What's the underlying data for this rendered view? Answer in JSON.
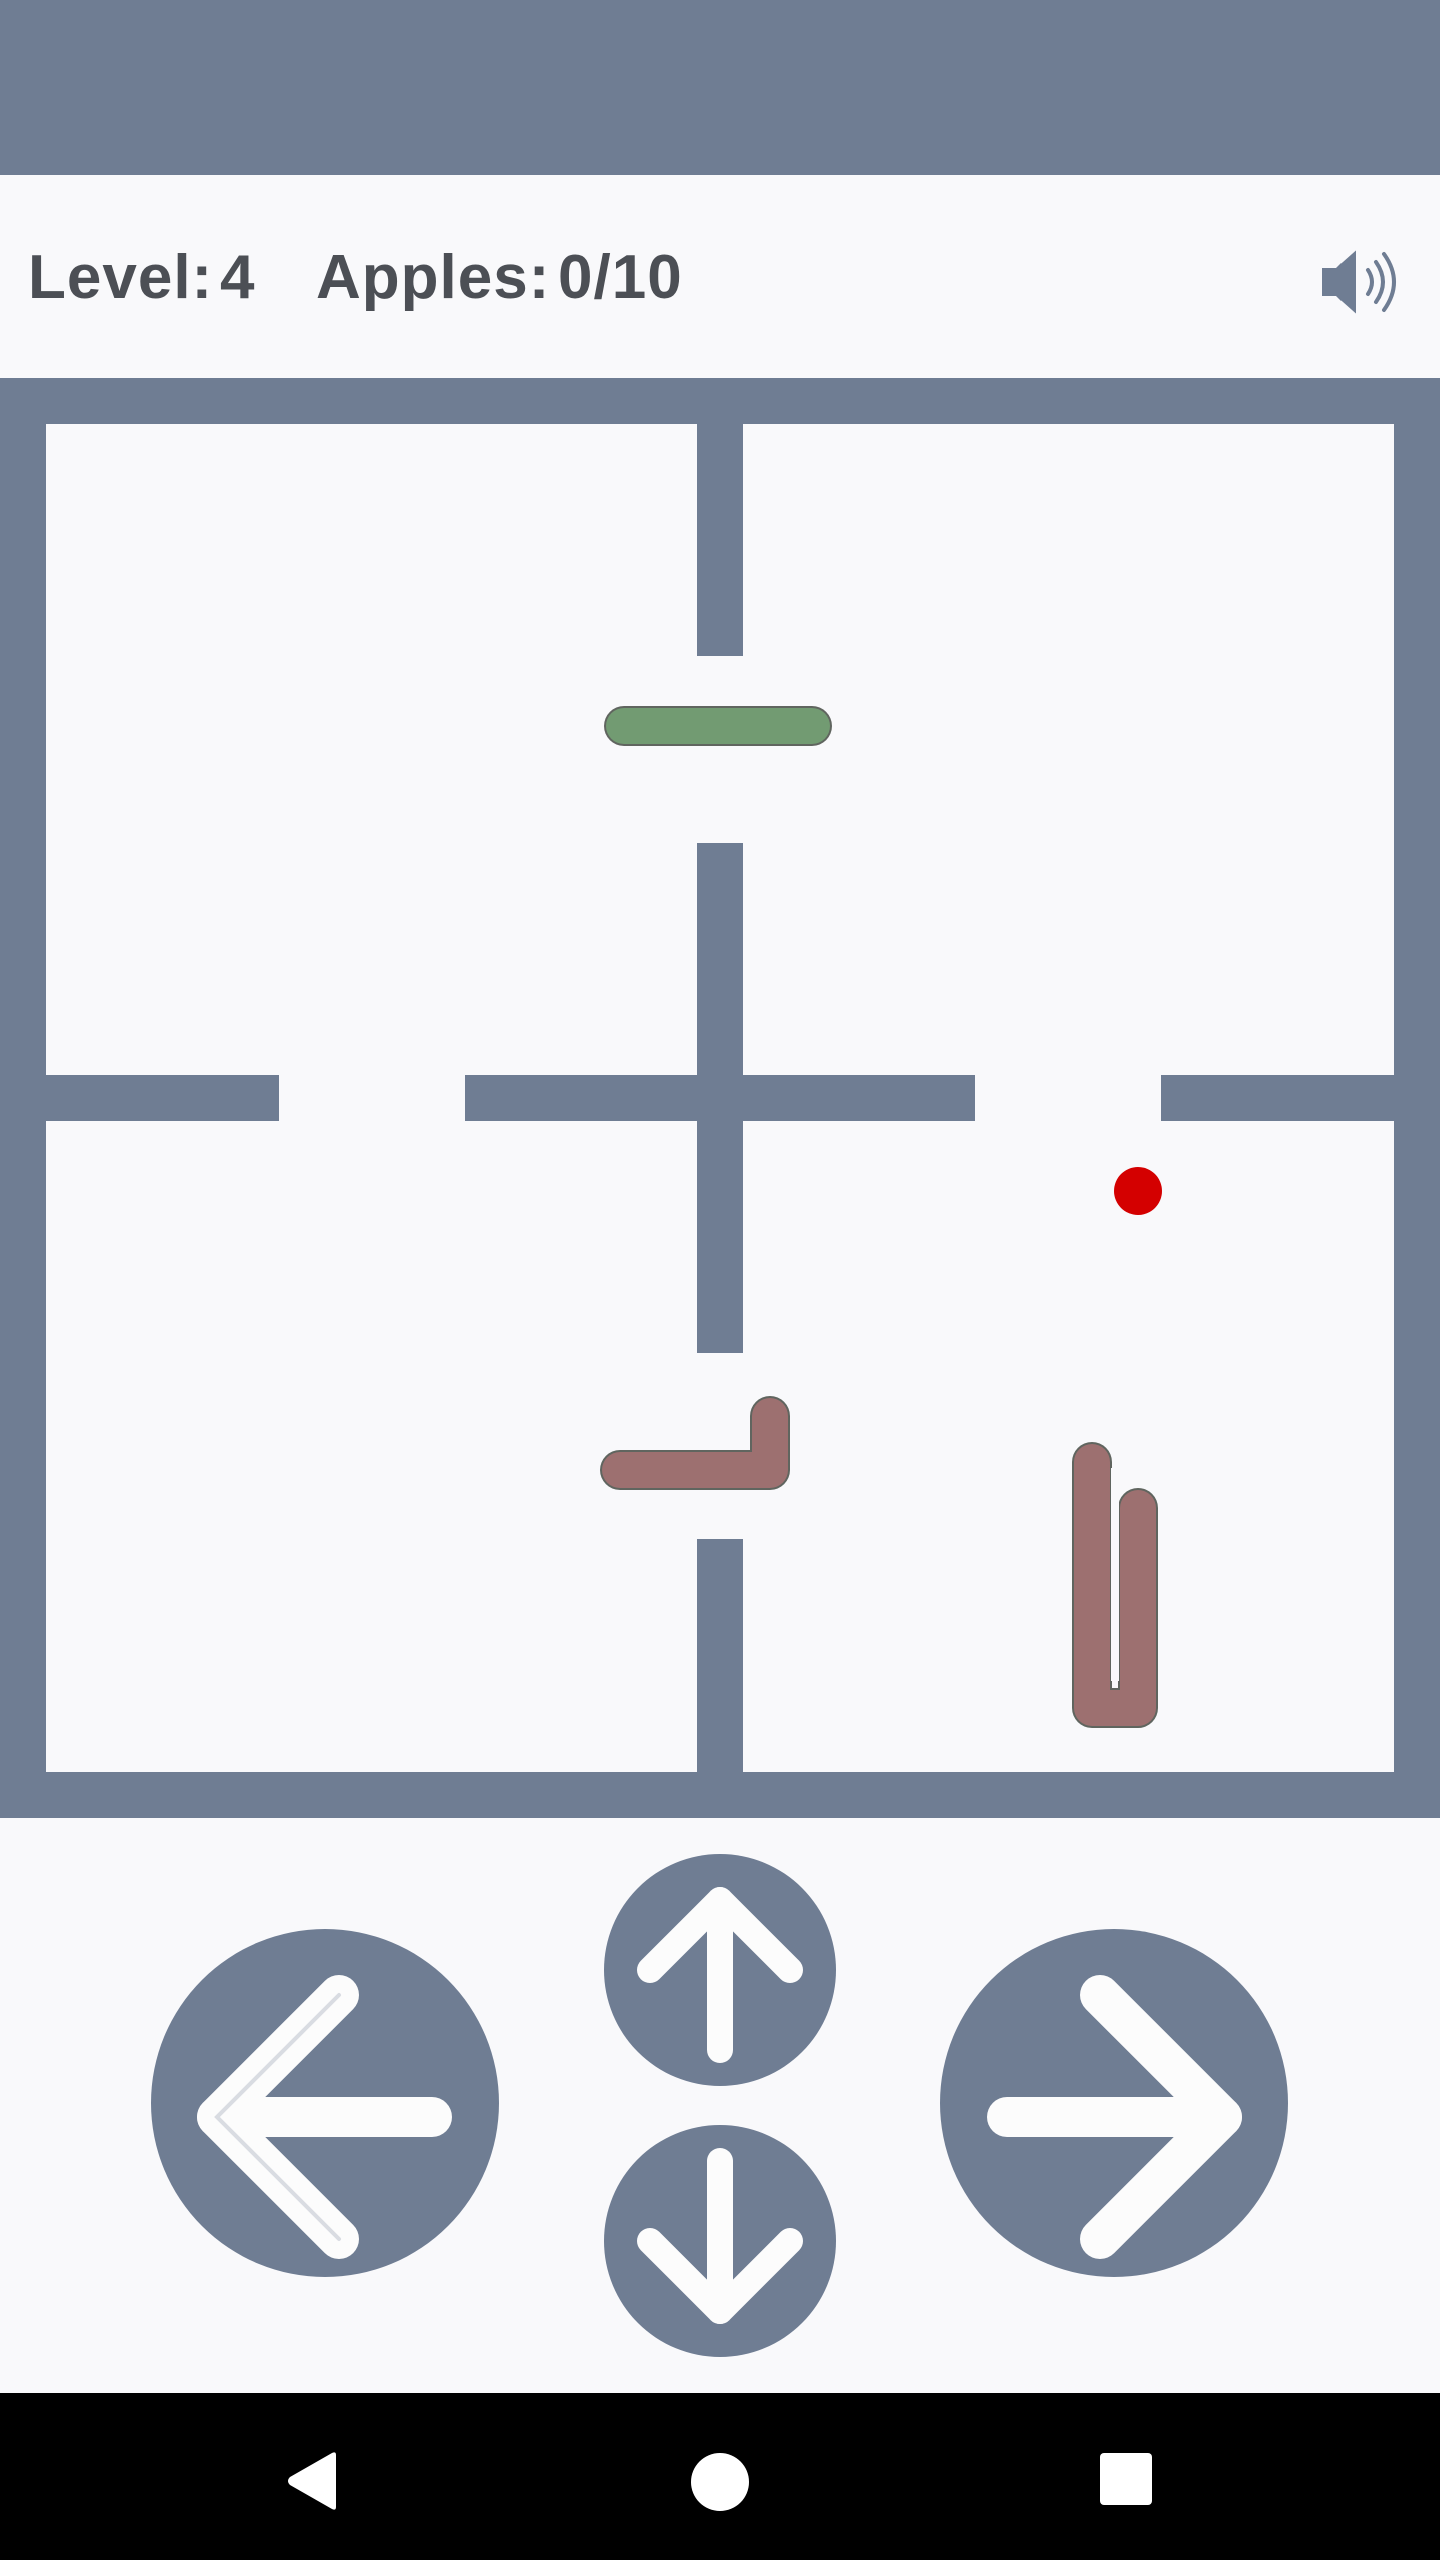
{
  "info": {
    "level_label": "Level:",
    "level_value": "4",
    "apples_label": "Apples:",
    "apples_value": "0/10",
    "sound_icon": "speaker-icon"
  },
  "game": {
    "colors": {
      "wall": "#6f7d93",
      "floor": "#f9f9fb",
      "player_snake": "#729b72",
      "enemy_snake": "#9d7070",
      "apple": "#d40000"
    }
  },
  "controls": {
    "left_icon": "arrow-left-icon",
    "up_icon": "arrow-up-icon",
    "down_icon": "arrow-down-icon",
    "right_icon": "arrow-right-icon",
    "button_color": "#6f7d93"
  },
  "navigation": {
    "back_icon": "back-triangle-icon",
    "home_icon": "home-circle-icon",
    "recents_icon": "recents-square-icon"
  }
}
